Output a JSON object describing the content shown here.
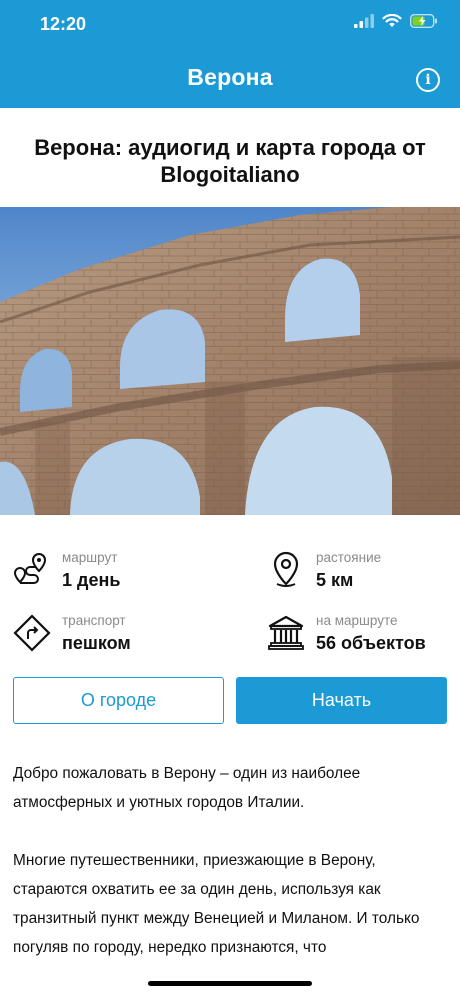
{
  "status": {
    "time": "12:20"
  },
  "nav": {
    "title": "Верона",
    "info_icon": "info-icon"
  },
  "page": {
    "title": "Верона: аудиогид и карта города от Blogoitaliano"
  },
  "info": {
    "route": {
      "label": "маршрут",
      "value": "1 день",
      "icon": "route-icon"
    },
    "distance": {
      "label": "растояние",
      "value": "5 км",
      "icon": "location-pin-icon"
    },
    "transport": {
      "label": "транспорт",
      "value": "пешком",
      "icon": "direction-sign-icon"
    },
    "objects": {
      "label": "на маршруте",
      "value": "56 объектов",
      "icon": "museum-icon"
    }
  },
  "buttons": {
    "about": "О городе",
    "start": "Начать"
  },
  "description": {
    "p1": "Добро пожаловать в Верону –  один из наиболее атмосферных и уютных городов Италии.",
    "p2": "Многие путешественники, приезжающие в Верону, стараются охватить ее за один день, используя как транзитный пункт между Венецией и Миланом. И только погуляв по городу, нередко признаются, что"
  },
  "colors": {
    "accent": "#1b9ad6",
    "text": "#111111",
    "muted": "#8a8a8a"
  }
}
